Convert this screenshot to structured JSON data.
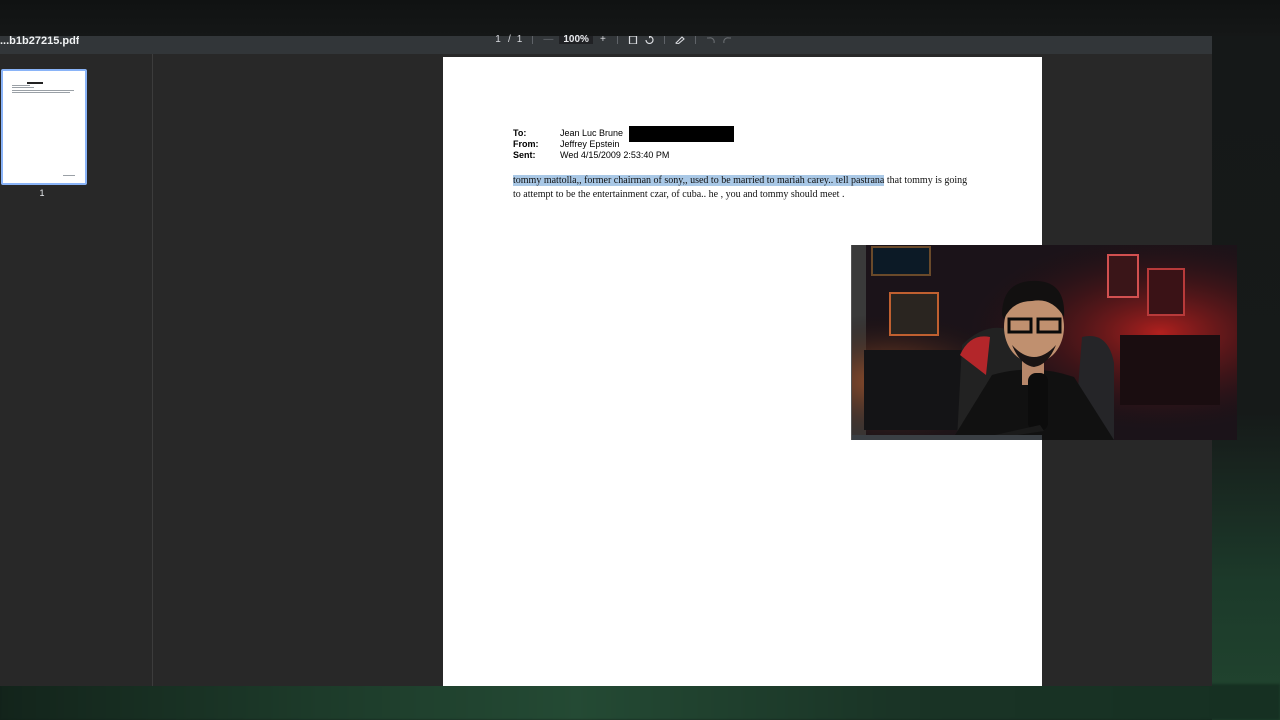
{
  "toolbar": {
    "doc_title": "...b1b27215.pdf",
    "page_current": "1",
    "page_sep": "/",
    "page_total": "1",
    "zoom_out": "—",
    "zoom_value": "100%",
    "zoom_in": "+",
    "fit_icon": "fit-page-icon",
    "rotate_icon": "rotate-icon",
    "annotate_icon": "annotate-icon",
    "undo_icon": "undo-icon",
    "redo_icon": "redo-icon"
  },
  "sidebar": {
    "thumbnails": [
      {
        "page_label": "1",
        "selected": true
      }
    ]
  },
  "document": {
    "headers": [
      {
        "label": "To:",
        "value": "Jean Luc Brune"
      },
      {
        "label": "From:",
        "value": "Jeffrey Epstein"
      },
      {
        "label": "Sent:",
        "value": "Wed 4/15/2009 2:53:40 PM"
      }
    ],
    "body_highlighted": "tommy mattolla,, former chairman of sony,, used to be married to mariah carey.. tell pastrana",
    "body_rest": " that tommy is going to attempt to be the entertainment czar, of cuba.. he , you and tommy should meet ."
  },
  "colors": {
    "viewer_bg": "#282828",
    "toolbar_bg": "#323639",
    "selection_highlight": "#a9c8e6",
    "thumbnail_border": "#8ab4f8"
  }
}
